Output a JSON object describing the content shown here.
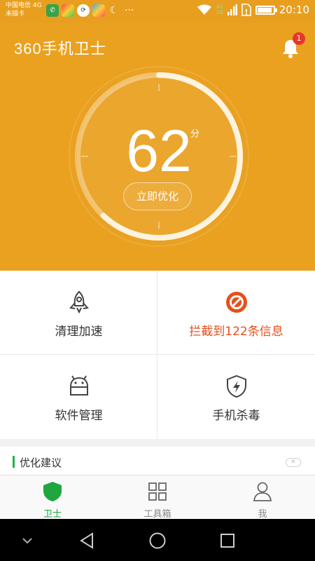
{
  "status_bar": {
    "carrier_line1": "中国电信 4G",
    "carrier_line2": "未插卡",
    "network_labels": [
      "4G",
      "2G"
    ],
    "time": "20:10",
    "battery_level": 0.9,
    "app_icons": [
      "wifi-calling-app-icon",
      "photos-app-icon",
      "sync-app-icon",
      "photos-app-icon",
      "weather-app-icon"
    ],
    "overflow": "···"
  },
  "header": {
    "app_title": "360手机卫士",
    "notification_count": "1",
    "colors": {
      "background": "#eaa120",
      "badge": "#e8352b"
    }
  },
  "score_panel": {
    "score": "62",
    "score_unit": "分",
    "progress": 0.62,
    "action_label": "立即优化"
  },
  "features": [
    {
      "label": "清理加速",
      "icon": "rocket-icon"
    },
    {
      "label": "拦截到122条信息",
      "icon": "block-icon",
      "color": "#e4501c"
    },
    {
      "label": "软件管理",
      "icon": "android-icon"
    },
    {
      "label": "手机杀毒",
      "icon": "shield-bolt-icon"
    }
  ],
  "suggestion": {
    "title": "优化建议",
    "close_label": "✕"
  },
  "tabs": [
    {
      "label": "卫士",
      "icon": "shield-icon",
      "active": true
    },
    {
      "label": "工具箱",
      "icon": "grid-icon",
      "active": false
    },
    {
      "label": "我",
      "icon": "person-icon",
      "active": false
    }
  ],
  "nav_bar": {
    "buttons": [
      "chevron-down-icon",
      "back-icon",
      "home-icon",
      "recents-icon"
    ]
  }
}
